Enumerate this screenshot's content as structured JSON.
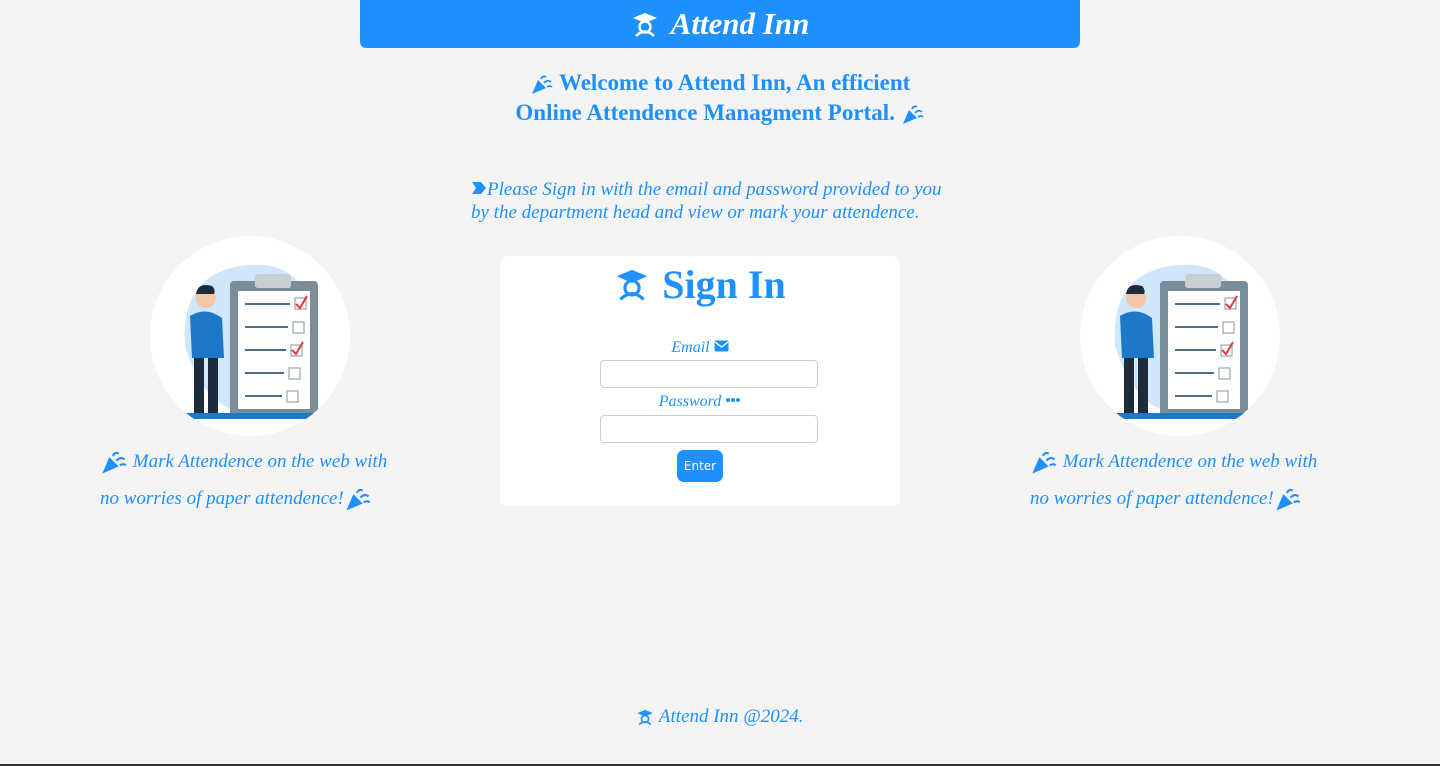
{
  "header": {
    "brand": "Attend Inn",
    "icon": "graduate-icon"
  },
  "welcome": {
    "line1": "Welcome to Attend Inn, An efficient",
    "line2": "Online Attendence Managment Portal.",
    "icon": "party-popper-icon"
  },
  "instruction": {
    "line1": "Please Sign in with the email and password provided to you",
    "line2": "by the department head and view or mark your attendence.",
    "icon": "chevron-tag-icon"
  },
  "side_left": {
    "line1": "Mark Attendence on the web with",
    "line2": "no worries of paper attendence!"
  },
  "side_right": {
    "line1": "Mark Attendence on the web with",
    "line2": "no worries of paper attendence!"
  },
  "signin": {
    "title": "Sign In",
    "email_label": "Email",
    "email_value": "",
    "password_label": "Password",
    "password_value": "",
    "enter_label": "Enter"
  },
  "footer": {
    "text": "Attend Inn @2024."
  },
  "colors": {
    "accent": "#1e90ff",
    "background": "#f4f4f4",
    "card": "#ffffff"
  }
}
